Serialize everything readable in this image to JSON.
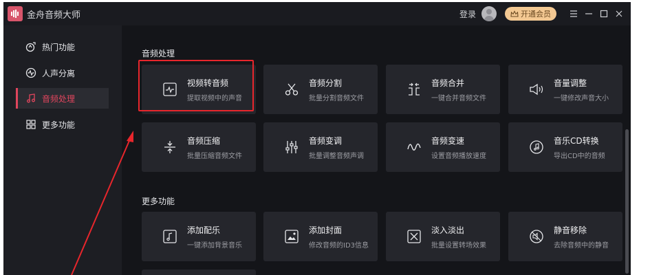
{
  "app": {
    "title": "金舟音频大师"
  },
  "header": {
    "login": "登录",
    "vip_label": "开通会员"
  },
  "sidebar": {
    "items": [
      {
        "label": "热门功能",
        "icon": "hot-icon"
      },
      {
        "label": "人声分离",
        "icon": "waveform-icon"
      },
      {
        "label": "音频处理",
        "icon": "music-note-icon"
      },
      {
        "label": "更多功能",
        "icon": "grid-icon"
      }
    ],
    "active_index": 2
  },
  "sections": [
    {
      "title": "音频处理",
      "cards": [
        {
          "title": "视频转音频",
          "sub": "提取视频中的声音",
          "icon": "video-to-audio-icon"
        },
        {
          "title": "音频分割",
          "sub": "批量分割音频文件",
          "icon": "scissors-icon"
        },
        {
          "title": "音频合并",
          "sub": "一键合并音频文件",
          "icon": "merge-icon"
        },
        {
          "title": "音量调整",
          "sub": "一键修改声音大小",
          "icon": "volume-icon"
        },
        {
          "title": "音频压缩",
          "sub": "批量压缩音频文件",
          "icon": "compress-icon"
        },
        {
          "title": "音频变调",
          "sub": "批量调整音频声调",
          "icon": "equalizer-icon"
        },
        {
          "title": "音频变速",
          "sub": "设置音频播放速度",
          "icon": "wave-speed-icon"
        },
        {
          "title": "音乐CD转换",
          "sub": "导出CD中的音频",
          "icon": "cd-icon"
        }
      ]
    },
    {
      "title": "更多功能",
      "cards": [
        {
          "title": "添加配乐",
          "sub": "一键添加背景音乐",
          "icon": "add-music-icon"
        },
        {
          "title": "添加封面",
          "sub": "修改音频的ID3信息",
          "icon": "cover-image-icon"
        },
        {
          "title": "淡入淡出",
          "sub": "批量设置转场效果",
          "icon": "fade-icon"
        },
        {
          "title": "静音移除",
          "sub": "去除音频中的静音",
          "icon": "mute-remove-icon"
        }
      ]
    }
  ],
  "colors": {
    "accent": "#e0455d",
    "annotation": "#e8262c",
    "vip": "#f3c892"
  }
}
